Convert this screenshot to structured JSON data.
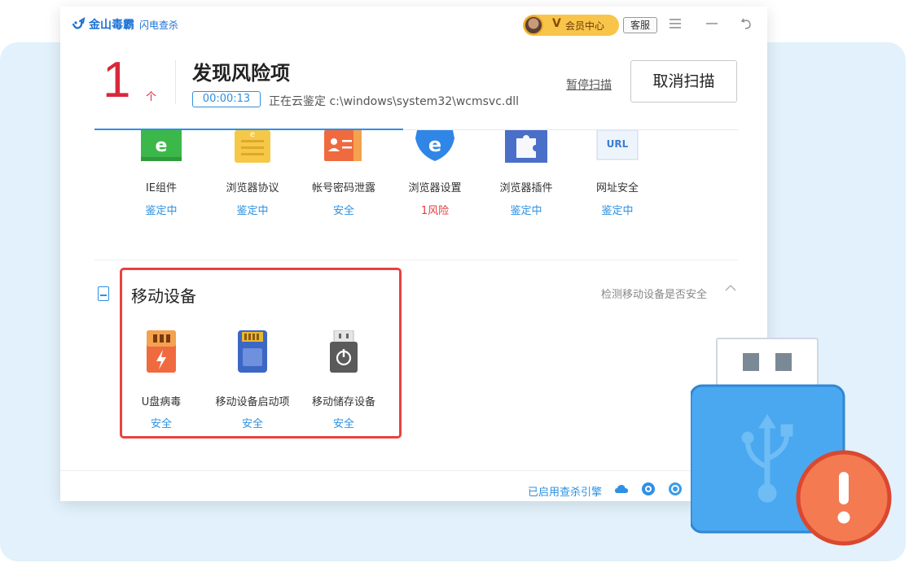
{
  "app": {
    "logo_name": "金山毒霸",
    "logo_sub": "闪电查杀",
    "vip_badge": "V",
    "vip_label": "会员中心",
    "service_label": "客服",
    "menu_icon": "menu-icon",
    "minimize_icon": "minimize-icon",
    "back_icon": "back-icon"
  },
  "scan": {
    "risk_count": "1",
    "risk_unit": "个",
    "headline": "发现风险项",
    "timer": "00:00:13",
    "status": "正在云鉴定 c:\\windows\\system32\\wcmsvc.dll",
    "pause_label": "暂停扫描",
    "cancel_label": "取消扫描",
    "progress": 0.48
  },
  "browser_items": [
    {
      "icon": "ie-component-icon",
      "label": "IE组件",
      "status": "鉴定中",
      "risk": false
    },
    {
      "icon": "browser-protocol-icon",
      "label": "浏览器协议",
      "status": "鉴定中",
      "risk": false
    },
    {
      "icon": "account-password-icon",
      "label": "帐号密码泄露",
      "status": "安全",
      "risk": false
    },
    {
      "icon": "browser-settings-icon",
      "label": "浏览器设置",
      "status": "1风险",
      "risk": true
    },
    {
      "icon": "browser-plugin-icon",
      "label": "浏览器插件",
      "status": "鉴定中",
      "risk": false
    },
    {
      "icon": "url-safety-icon",
      "label": "网址安全",
      "status": "鉴定中",
      "risk": false
    }
  ],
  "url_icon_text": "URL",
  "mobile_section": {
    "title": "移动设备",
    "hint": "检测移动设备是否安全",
    "items": [
      {
        "icon": "usb-virus-icon",
        "label": "U盘病毒",
        "status": "安全"
      },
      {
        "icon": "sd-card-icon",
        "label": "移动设备启动项",
        "status": "安全"
      },
      {
        "icon": "storage-device-icon",
        "label": "移动储存设备",
        "status": "安全"
      }
    ]
  },
  "footer": {
    "engine_text": "已启用查杀引擎"
  },
  "colors": {
    "accent": "#2e8fe6",
    "risk": "#e53c3c",
    "highlight_box": "#e8423f",
    "background_panel": "#e2f1fb"
  }
}
